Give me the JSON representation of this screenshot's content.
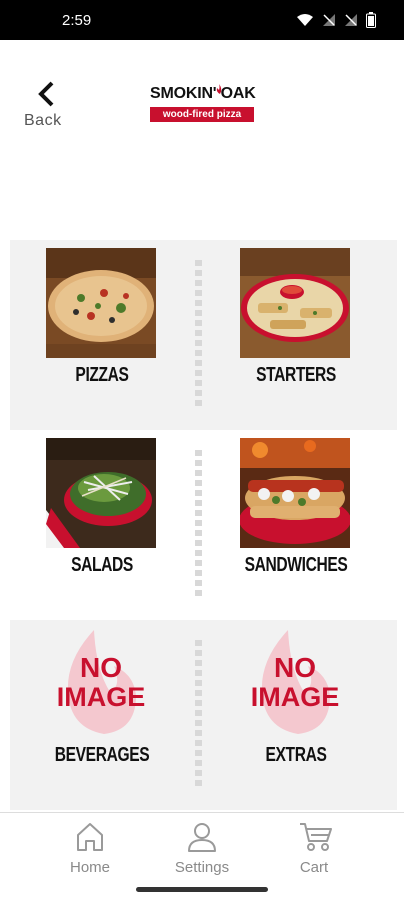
{
  "status_bar": {
    "time": "2:59",
    "icons": [
      "wifi-icon",
      "signal-off-icon",
      "signal-off-icon",
      "battery-icon"
    ]
  },
  "header": {
    "back_label": "Back",
    "logo": {
      "name": "SMOKIN' OAK",
      "tagline": "wood-fired pizza"
    }
  },
  "menu": {
    "categories": [
      {
        "label": "PIZZAS",
        "image": "pizza-photo"
      },
      {
        "label": "STARTERS",
        "image": "starters-photo"
      },
      {
        "label": "SALADS",
        "image": "salad-photo"
      },
      {
        "label": "SANDWICHES",
        "image": "sandwich-photo"
      },
      {
        "label": "BEVERAGES",
        "image": "no-image",
        "placeholder_line1": "NO",
        "placeholder_line2": "IMAGE"
      },
      {
        "label": "EXTRAS",
        "image": "no-image",
        "placeholder_line1": "NO",
        "placeholder_line2": "IMAGE"
      }
    ]
  },
  "bottom_nav": {
    "items": [
      {
        "label": "Home",
        "icon": "home-icon"
      },
      {
        "label": "Settings",
        "icon": "user-icon"
      },
      {
        "label": "Cart",
        "icon": "cart-icon"
      }
    ]
  },
  "colors": {
    "brand_red": "#c8102e",
    "tile_gray": "#f2f2f2",
    "nav_text": "#8a8a8a"
  }
}
